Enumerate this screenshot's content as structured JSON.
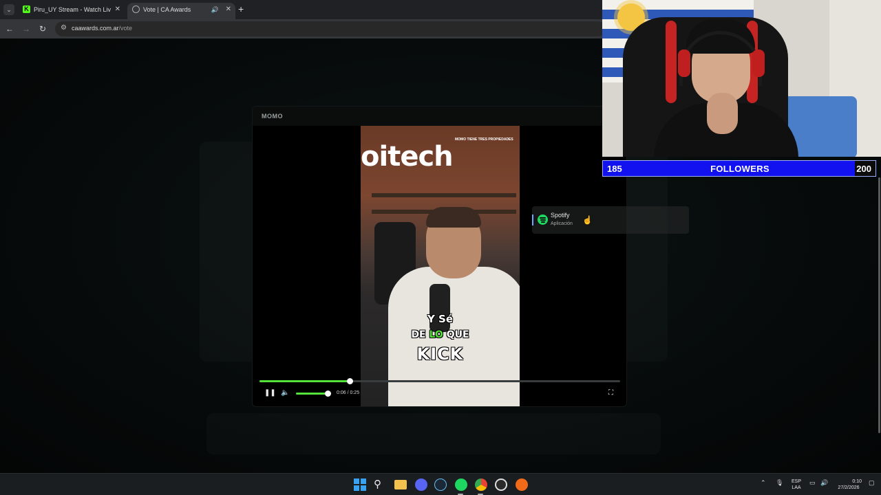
{
  "browser": {
    "tabs": [
      {
        "title": "Piru_UY Stream - Watch Live on",
        "icon": "kick-favicon",
        "active": false
      },
      {
        "title": "Vote | CA Awards",
        "icon": "globe-favicon",
        "active": true,
        "audio": true
      }
    ],
    "new_tab_symbol": "+",
    "close_symbol": "✕",
    "url_host": "caawards.com.ar",
    "url_path": "/vote"
  },
  "modal": {
    "title": "MOMO",
    "video": {
      "brand_text": "oitech",
      "top_caption": "MOMO TIENE TRES PROPIEDADES",
      "subtitle_line1": "Y Sé",
      "subtitle_line2_a": "DE ",
      "subtitle_line2_hl": "LO",
      "subtitle_line2_b": " QUE",
      "subtitle_line3": "KICK"
    },
    "player": {
      "progress": 0.25,
      "volume": 0.92,
      "time": "0:06 / 0:25",
      "accent": "#55e23a"
    }
  },
  "tooltip": {
    "app_name": "Spotify",
    "app_type": "Aplicación",
    "icon": "spotify-icon",
    "color": "#1ed760"
  },
  "overlay": {
    "followers_current": "185",
    "followers_label": "FOLLOWERS",
    "followers_goal": "200",
    "progress": 0.925,
    "bar_color": "#1212f0"
  },
  "taskbar": {
    "apps": [
      "windows-start",
      "search",
      "file-explorer",
      "discord",
      "steam",
      "spotify",
      "chrome",
      "obs",
      "origin"
    ],
    "lang_top": "ESP",
    "lang_bottom": "LAA",
    "time": "0:10",
    "date": "27/2/2026"
  }
}
